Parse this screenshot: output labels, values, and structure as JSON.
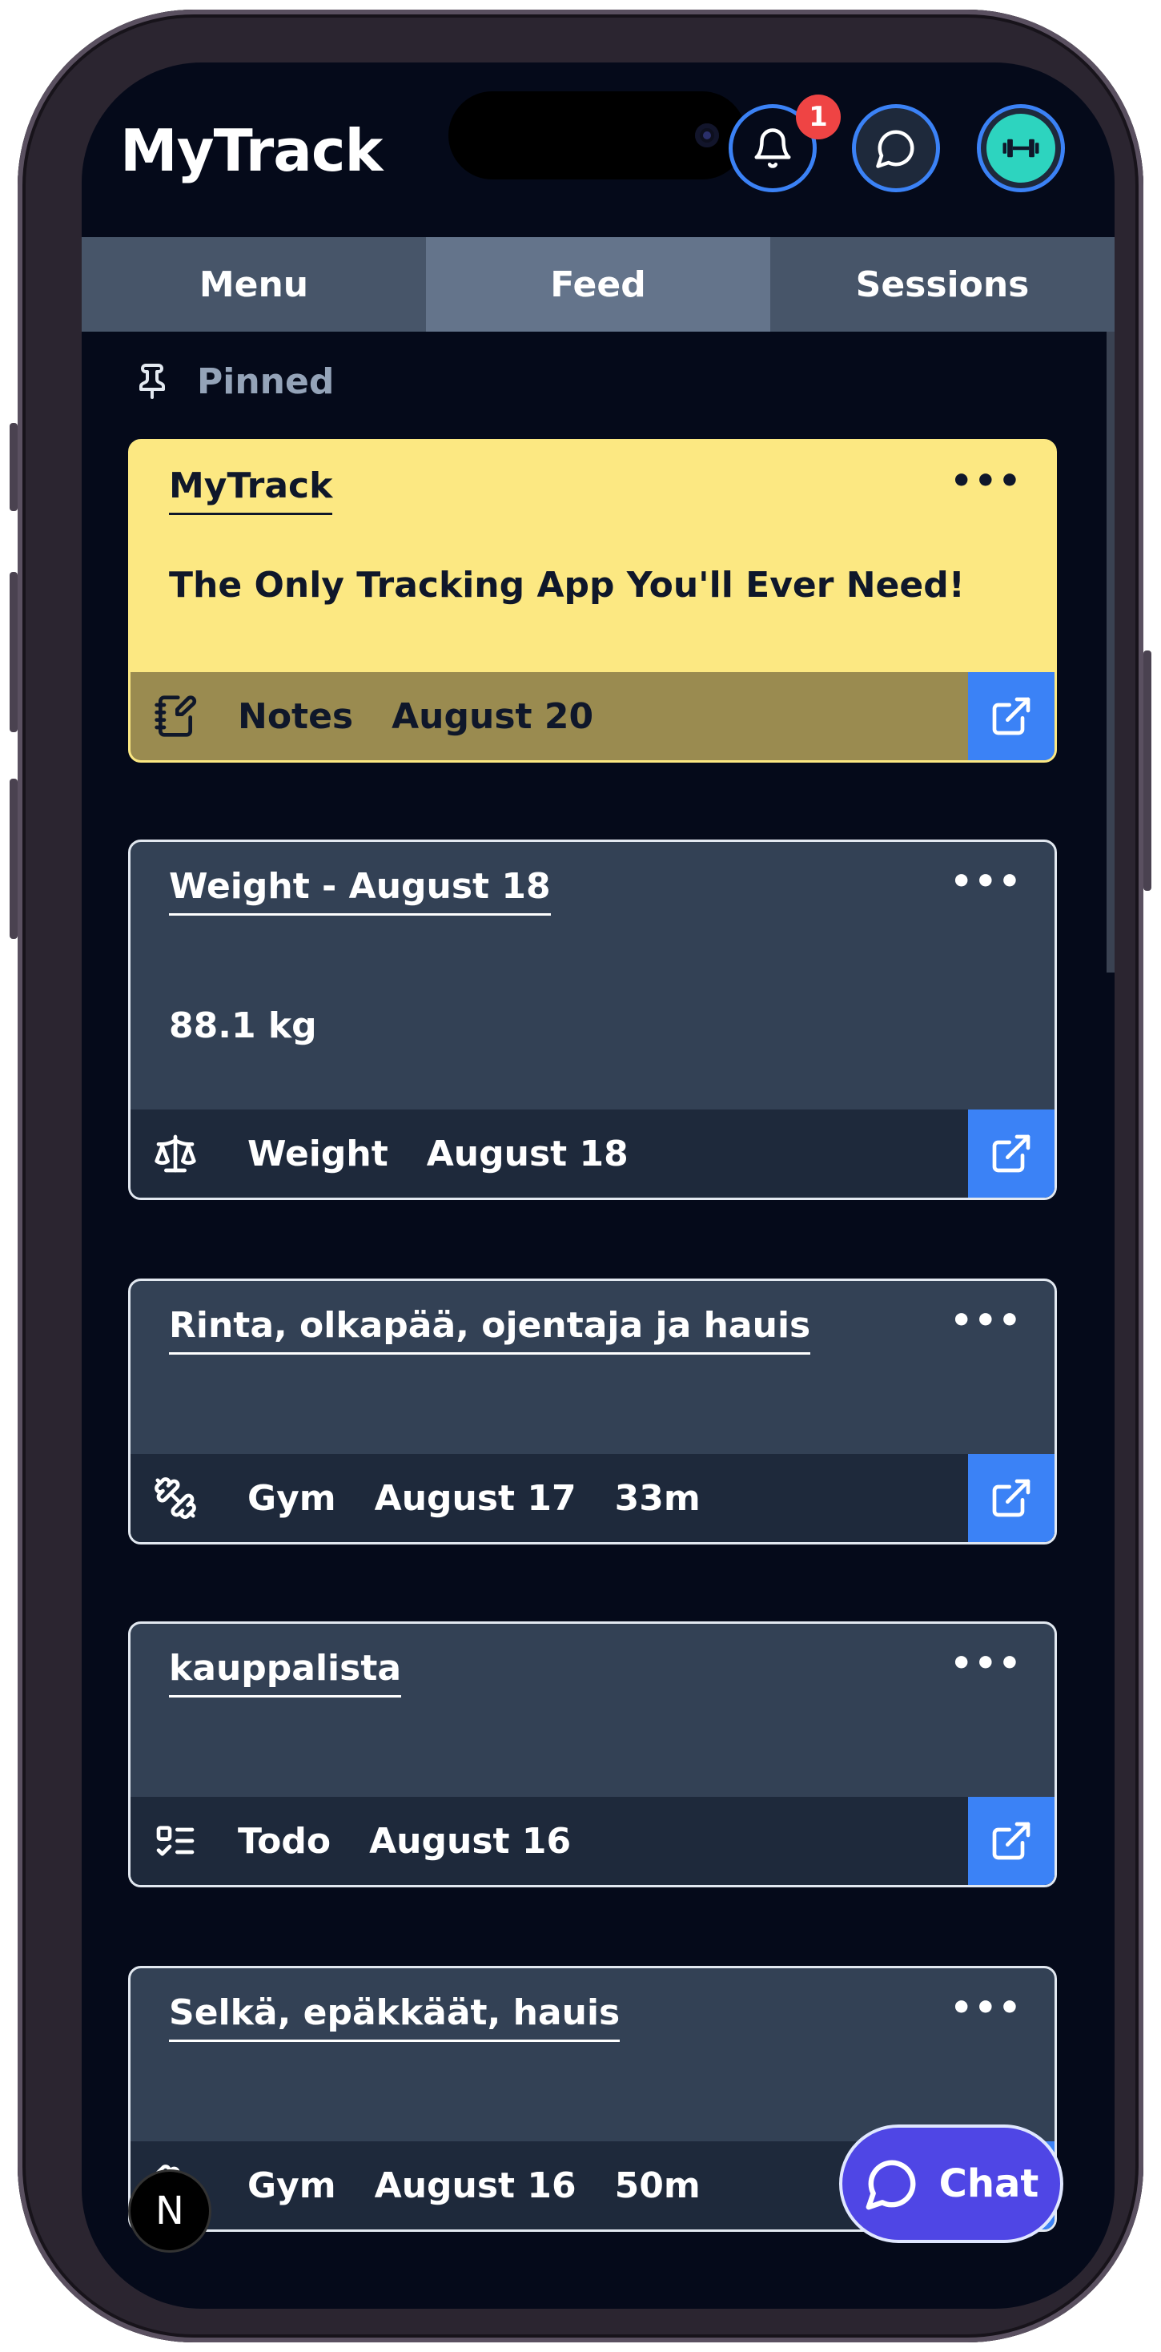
{
  "app": {
    "brand": "MyTrack"
  },
  "header": {
    "notification_count": "1"
  },
  "tabs": [
    {
      "label": "Menu"
    },
    {
      "label": "Feed",
      "active": true
    },
    {
      "label": "Sessions"
    }
  ],
  "pinned_label": "Pinned",
  "cards": [
    {
      "title": "MyTrack",
      "body": "The Only Tracking App You'll Ever Need!",
      "type": "Notes",
      "date": "August 20",
      "icon": "notes-icon",
      "pinned": true
    },
    {
      "title": "Weight - August 18",
      "body": "88.1 kg",
      "type": "Weight",
      "date": "August 18",
      "icon": "scale-icon"
    },
    {
      "title": "Rinta, olkapää, ojentaja ja hauis",
      "type": "Gym",
      "date": "August 17",
      "duration": "33m",
      "icon": "dumbbell-icon"
    },
    {
      "title": "kauppalista",
      "type": "Todo",
      "date": "August 16",
      "icon": "checklist-icon"
    },
    {
      "title": "Selkä, epäkkäät, hauis",
      "type": "Gym",
      "date": "August 16",
      "duration": "50m",
      "icon": "dumbbell-icon"
    }
  ],
  "chat_button": {
    "label": "Chat"
  },
  "dev_badge": {
    "label": "N"
  },
  "colors": {
    "accent": "#3b82f6",
    "pinned_card": "#fce882",
    "chat": "#4f46e5",
    "card": "#334155"
  }
}
